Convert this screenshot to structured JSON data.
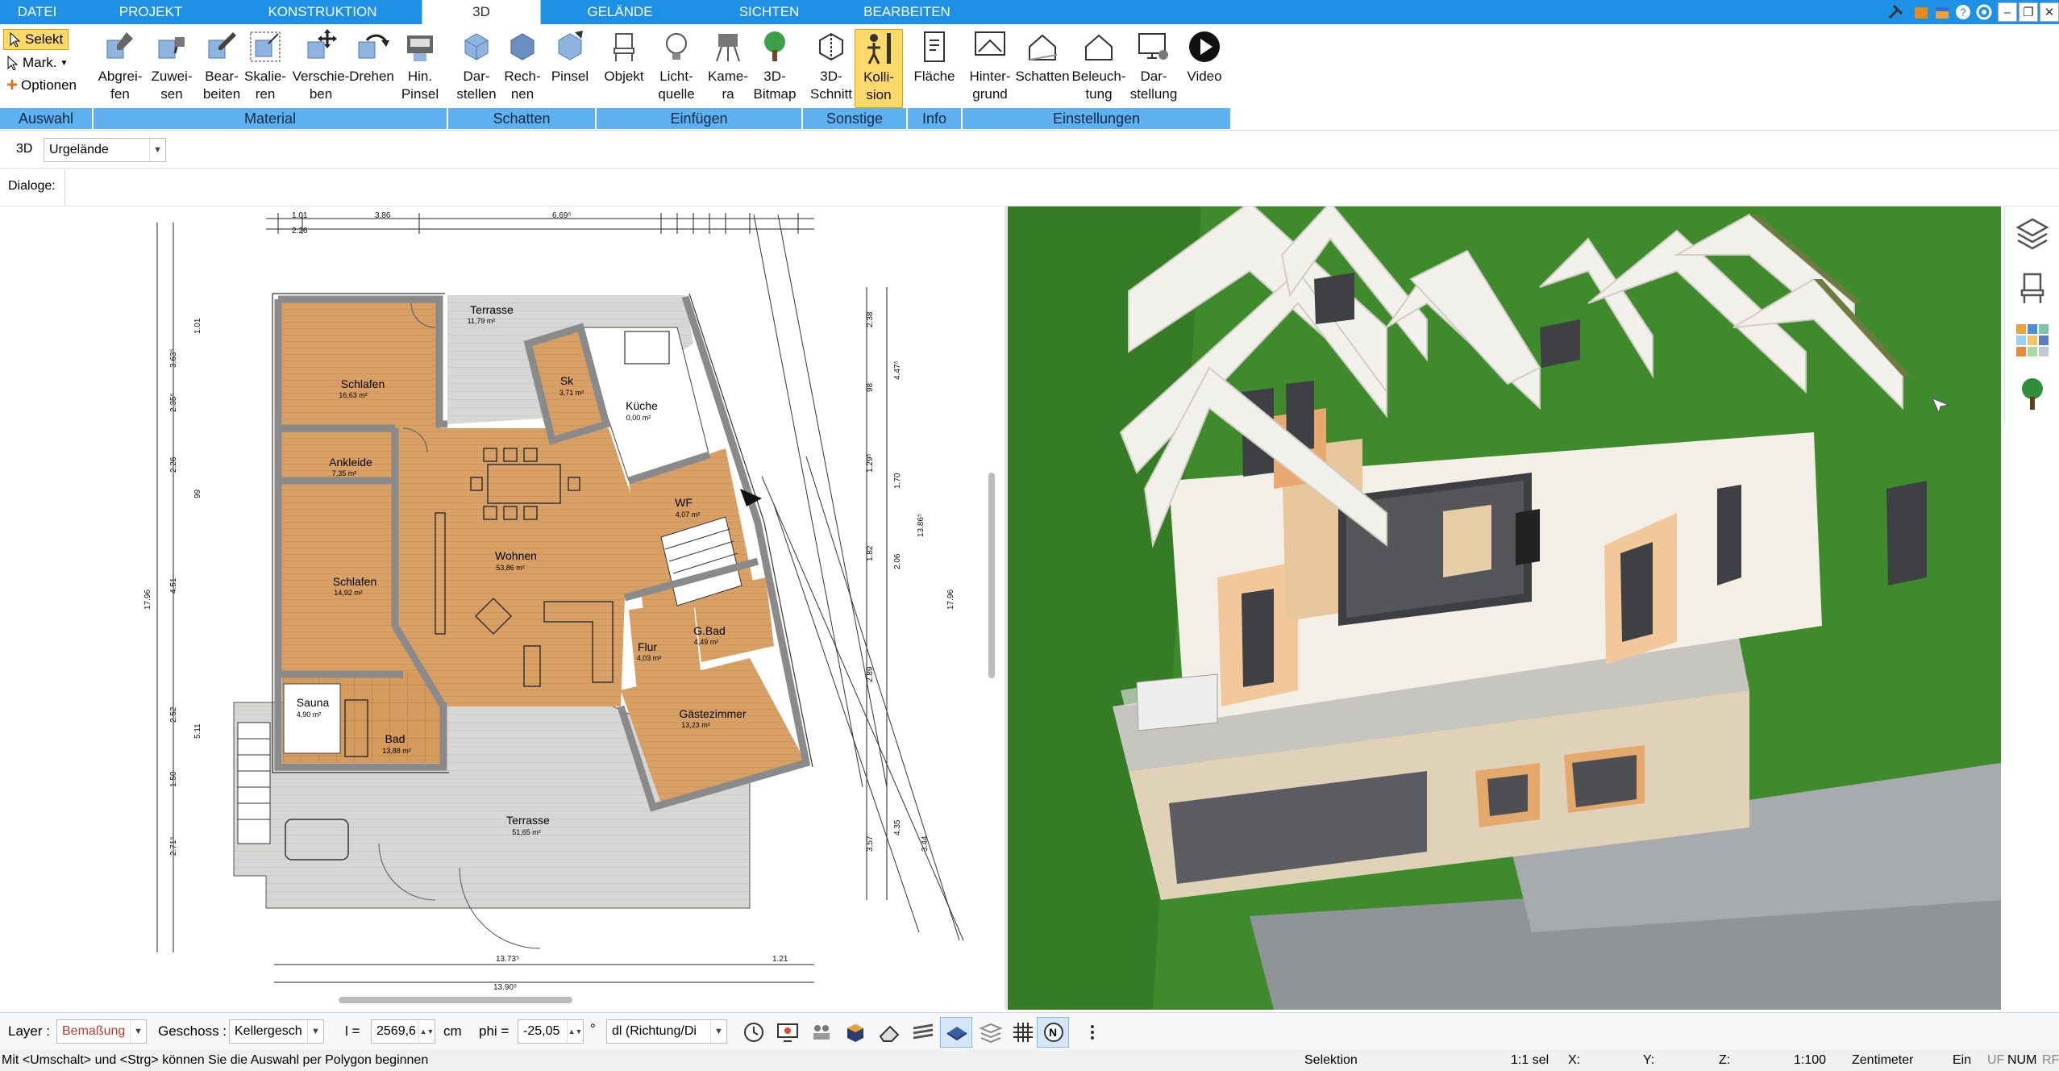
{
  "menu": {
    "tabs": [
      "DATEI",
      "PROJEKT",
      "KONSTRUKTION",
      "3D",
      "GELÄNDE",
      "SICHTEN",
      "BEARBEITEN"
    ],
    "active": "3D"
  },
  "window_controls": [
    "–",
    "❐",
    "✕"
  ],
  "ribbon": {
    "selection": {
      "select": "Selekt",
      "mark": "Mark.",
      "options": "Optionen"
    },
    "buttons": {
      "abgreifen": "Abgrei-\nfen",
      "zuweisen": "Zuwei-\nsen",
      "bearbeiten": "Bear-\nbeiten",
      "skalieren": "Skalie-\nren",
      "verschieben": "Verschie-\nben",
      "drehen": "Drehen",
      "hin_pinsel": "Hin.\nPinsel",
      "darstellen": "Dar-\nstellen",
      "rechnen": "Rech-\nnen",
      "pinsel": "Pinsel",
      "objekt": "Objekt",
      "lichtquelle": "Licht-\nquelle",
      "kamera": "Kame-\nra",
      "bitmap": "3D-\nBitmap",
      "schnitt": "3D-\nSchnitt",
      "kollision": "Kolli-\nsion",
      "flaeche": "Fläche",
      "hintergrund": "Hinter-\ngrund",
      "schatten_btn": "Schatten",
      "beleuchtung": "Beleuch-\ntung",
      "darstellung": "Dar-\nstellung",
      "video": "Video"
    },
    "groups": {
      "auswahl": "Auswahl",
      "material": "Material",
      "schatten": "Schatten",
      "einfuegen": "Einfügen",
      "sonstige": "Sonstige",
      "info": "Info",
      "einstellungen": "Einstellungen"
    }
  },
  "view_bar": {
    "mode": "3D",
    "terrain": "Urgelände"
  },
  "dialog_bar": {
    "label": "Dialoge:"
  },
  "plan": {
    "rooms": [
      {
        "name": "Schlafen",
        "area": "16,63 m²"
      },
      {
        "name": "Ankleide",
        "area": "7,35 m²"
      },
      {
        "name": "Schlafen",
        "area": "14,92 m²"
      },
      {
        "name": "Sauna",
        "area": "4,90 m²"
      },
      {
        "name": "Bad",
        "area": "13,88 m²"
      },
      {
        "name": "Wohnen",
        "area": "53,86 m²"
      },
      {
        "name": "Terrasse",
        "area": "11,79 m²"
      },
      {
        "name": "Sk",
        "area": "3,71 m²"
      },
      {
        "name": "Küche",
        "area": "0,00 m²"
      },
      {
        "name": "WF",
        "area": "4,07 m²"
      },
      {
        "name": "Flur",
        "area": "4,03 m²"
      },
      {
        "name": "G.Bad",
        "area": "4,49 m²"
      },
      {
        "name": "Gästezimmer",
        "area": "13,23 m²"
      },
      {
        "name": "Terrasse",
        "area": "51,65 m²"
      }
    ],
    "dims_top": [
      "1.01",
      "2.26",
      "3.86",
      "6.69⁵"
    ],
    "dims_bottom": [
      "13.73⁵",
      "13.90⁵",
      "1.21"
    ],
    "dims_left": [
      "3.63⁵",
      "2.35⁵",
      "2.26",
      "99",
      "4.51",
      "2.52",
      "5.11",
      "1.50",
      "2.71⁵",
      "17.96",
      "1.01"
    ],
    "dims_right": [
      "2.38",
      "4.47⁵",
      "98",
      "1.29⁵",
      "1.70",
      "1.82",
      "2.06",
      "13.86⁵",
      "17.96",
      "2.89",
      "3.57",
      "4.35",
      "3.44"
    ]
  },
  "side_icons": [
    "layers-icon",
    "chair-icon",
    "palette-icon",
    "tree-icon"
  ],
  "bottom": {
    "layer_label": "Layer :",
    "layer_value": "Bemaßung",
    "floor_label": "Geschoss :",
    "floor_value": "Kellergesch",
    "l_label": "l =",
    "l_value": "2569,6",
    "l_unit": "cm",
    "phi_label": "phi =",
    "phi_value": "-25,05",
    "phi_unit": "°",
    "dl_value": "dl (Richtung/Di"
  },
  "status": {
    "hint": "Mit <Umschalt> und <Strg> können Sie die Auswahl per Polygon beginnen",
    "mode": "Selektion",
    "sel": "1:1 sel",
    "x": "X:",
    "y": "Y:",
    "z": "Z:",
    "scale": "1:100",
    "unit": "Zentimeter",
    "ein": "Ein",
    "uf": "UF",
    "num": "NUM",
    "rf": "RF"
  },
  "colors": {
    "accent": "#1e90e6",
    "group": "#5fb0ef",
    "wood": "#d9a066",
    "grass": "#3f8a2c",
    "roof": "#f2f0ea"
  }
}
